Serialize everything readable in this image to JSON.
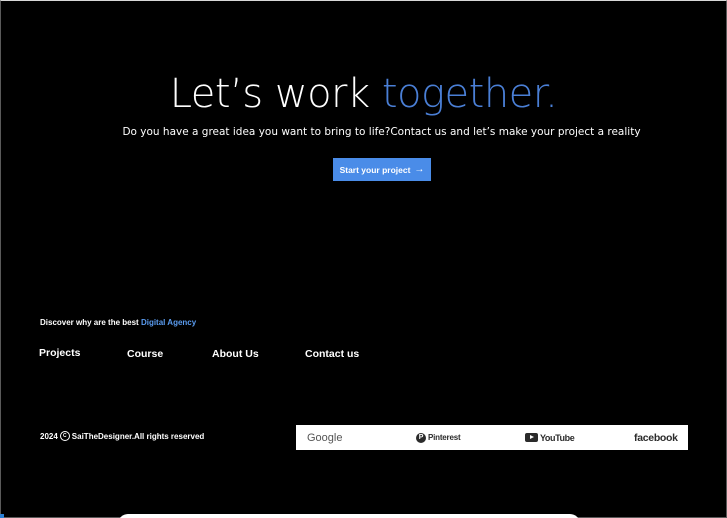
{
  "hero": {
    "title_main": "Let’s work ",
    "title_accent": "together.",
    "subtitle": "Do you have a great idea you want to bring to life?Contact us and let’s make your project a reality",
    "cta_label": "Start your project",
    "cta_arrow": "→"
  },
  "footer": {
    "tagline_prefix": "Discover why are the best ",
    "tagline_accent": "Digital Agency",
    "nav": {
      "projects": "Projects",
      "course": "Course",
      "about": "About Us",
      "contact": "Contact us"
    },
    "copyright_year": "2024",
    "copyright_symbol": "C",
    "copyright_text": "SaiTheDesigner.All rights reserved",
    "brands": {
      "google": "Google",
      "pinterest": "Pinterest",
      "pinterest_glyph": "P",
      "youtube": "YouTube",
      "facebook": "facebook"
    }
  },
  "colors": {
    "background": "#000000",
    "accent": "#4a7fd6",
    "cta": "#4a8ce8"
  }
}
